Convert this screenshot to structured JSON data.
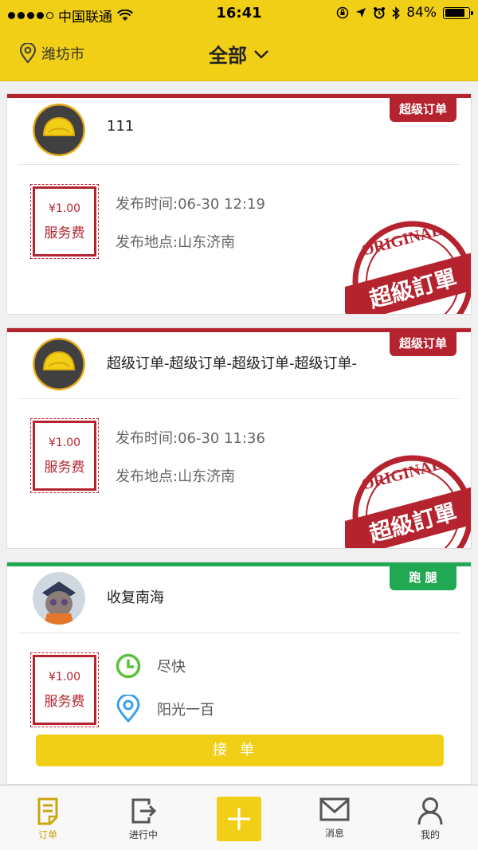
{
  "status": {
    "carrier": "中国联通",
    "time": "16:41",
    "battery": "84%",
    "battery_level": 0.84,
    "icons": [
      "signal-dots-icon",
      "wifi-icon",
      "rotation-lock-icon",
      "location-arrow-icon",
      "alarm-icon",
      "bluetooth-icon",
      "battery-icon"
    ]
  },
  "nav": {
    "city": "潍坊市",
    "title": "全部",
    "icons": [
      "location-pin-icon",
      "chevron-down-icon"
    ]
  },
  "colors": {
    "accent": "#f1cf17",
    "super": "#b4232e",
    "run": "#21a852"
  },
  "orders": [
    {
      "tag": "超级订单",
      "title": "111",
      "fee_value": "¥1.00",
      "fee_label": "服务费",
      "time_line": "发布时间:06-30 12:19",
      "place_line": "发布地点:山东济南",
      "stamp_text": "超級訂單",
      "stamp_word": "ORIGINAL"
    },
    {
      "tag": "超级订单",
      "title": "超级订单-超级订单-超级订单-超级订单-",
      "fee_value": "¥1.00",
      "fee_label": "服务费",
      "time_line": "发布时间:06-30 11:36",
      "place_line": "发布地点:山东济南",
      "stamp_text": "超級訂單",
      "stamp_word": "ORIGINAL"
    },
    {
      "tag": "跑 腿",
      "title": "收复南海",
      "fee_value": "¥1.00",
      "fee_label": "服务费",
      "time_text": "尽快",
      "place_text": "阳光一百",
      "accept_label": "接单"
    }
  ],
  "tabs": [
    {
      "label": "订单",
      "icon": "order-doc-icon",
      "active": true
    },
    {
      "label": "进行中",
      "icon": "exit-box-icon",
      "active": false
    },
    {
      "label": "",
      "icon": "plus-icon",
      "active": false
    },
    {
      "label": "消息",
      "icon": "mail-icon",
      "active": false
    },
    {
      "label": "我的",
      "icon": "person-icon",
      "active": false
    }
  ]
}
